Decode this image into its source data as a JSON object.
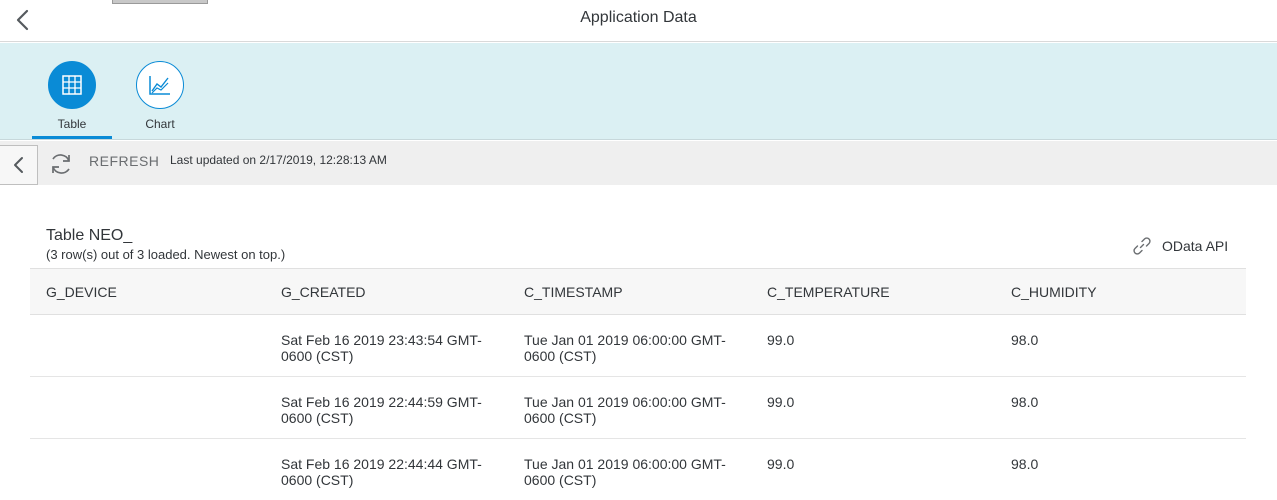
{
  "header": {
    "title": "Application Data",
    "back_icon": "chevron-left-icon"
  },
  "icon_tabs": [
    {
      "label": "Table",
      "icon": "table-grid-icon",
      "selected": true
    },
    {
      "label": "Chart",
      "icon": "line-chart-icon",
      "selected": false
    }
  ],
  "toolbar": {
    "back_icon": "chevron-left-icon",
    "refresh_icon": "refresh-icon",
    "refresh_label": "REFRESH",
    "last_updated": "Last updated on 2/17/2019, 12:28:13 AM"
  },
  "table": {
    "title": "Table NEO_",
    "subtitle": "(3 row(s) out of 3 loaded. Newest on top.)",
    "odata_label": "OData API",
    "odata_icon": "link-icon",
    "columns": [
      "G_DEVICE",
      "G_CREATED",
      "C_TIMESTAMP",
      "C_TEMPERATURE",
      "C_HUMIDITY"
    ],
    "rows": [
      {
        "device": "",
        "created": "Sat Feb 16 2019 23:43:54 GMT-0600 (CST)",
        "timestamp": "Tue Jan 01 2019 06:00:00 GMT-0600 (CST)",
        "temperature": "99.0",
        "humidity": "98.0"
      },
      {
        "device": "",
        "created": "Sat Feb 16 2019 22:44:59 GMT-0600 (CST)",
        "timestamp": "Tue Jan 01 2019 06:00:00 GMT-0600 (CST)",
        "temperature": "99.0",
        "humidity": "98.0"
      },
      {
        "device": "",
        "created": "Sat Feb 16 2019 22:44:44 GMT-0600 (CST)",
        "timestamp": "Tue Jan 01 2019 06:00:00 GMT-0600 (CST)",
        "temperature": "99.0",
        "humidity": "98.0"
      }
    ]
  },
  "colors": {
    "accent": "#0a8bd6",
    "tabbar_bg": "#dbf0f3",
    "toolbar_bg": "#efefef"
  }
}
